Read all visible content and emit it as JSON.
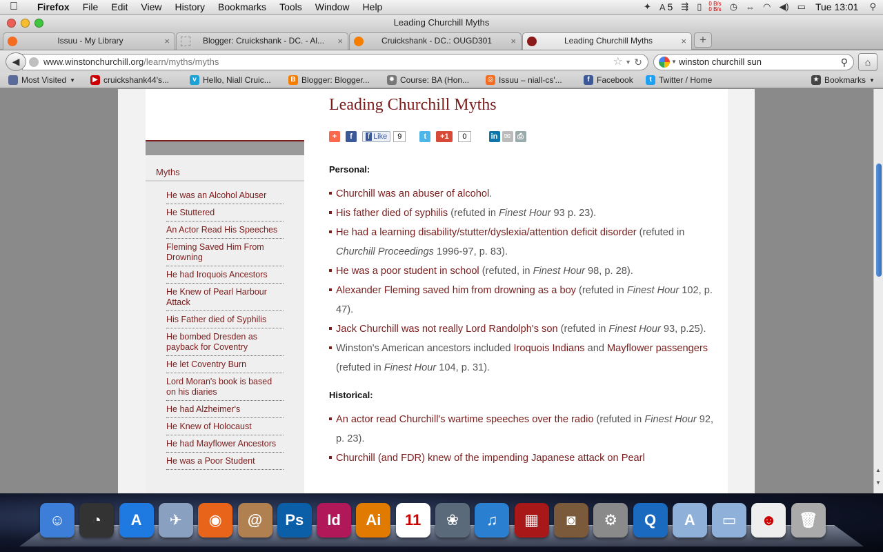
{
  "menubar": {
    "app": "Firefox",
    "menus": [
      "File",
      "Edit",
      "View",
      "History",
      "Bookmarks",
      "Tools",
      "Window",
      "Help"
    ],
    "adobe_count": "5",
    "net_up": "0 B/s",
    "net_down": "0 B/s",
    "clock": "Tue 13:01"
  },
  "window": {
    "title": "Leading Churchill Myths"
  },
  "tabs": [
    {
      "label": "Issuu - My Library",
      "fav_color": "#f36c21"
    },
    {
      "label": "Blogger: Cruickshank - DC. - Al...",
      "fav_color": "#ffffff"
    },
    {
      "label": "Cruickshank - DC.: OUGD301",
      "fav_color": "#f57d00"
    },
    {
      "label": "Leading Churchill Myths",
      "fav_color": "#8b1a1a"
    }
  ],
  "address": {
    "domain": "www.winstonchurchill.org",
    "path": "/learn/myths/myths"
  },
  "search": {
    "value": "winston churchill sun"
  },
  "bookmarks": [
    {
      "label": "Most Visited",
      "color": "#5a6a9a"
    },
    {
      "label": "cruickshank44's...",
      "color": "#cc0000"
    },
    {
      "label": "Hello, Niall Cruic...",
      "color": "#1aa1d6"
    },
    {
      "label": "Blogger: Blogger...",
      "color": "#f57d00"
    },
    {
      "label": "Course: BA (Hon...",
      "color": "#777777"
    },
    {
      "label": "Issuu – niall-cs'...",
      "color": "#f36c21"
    },
    {
      "label": "Facebook",
      "color": "#3b5998"
    },
    {
      "label": "Twitter / Home",
      "color": "#1da1f2"
    },
    {
      "label": "Bookmarks",
      "color": "#444444"
    }
  ],
  "sidebar": {
    "title": "Myths",
    "items": [
      "He was an Alcohol Abuser",
      "He Stuttered",
      "An Actor Read His Speeches",
      "Fleming Saved Him From Drowning",
      "He had Iroquois Ancestors",
      "He Knew of Pearl Harbour Attack",
      "His Father died of Syphilis",
      "He bombed Dresden as payback for Coventry",
      "He let Coventry Burn",
      "Lord Moran's book is based on his diaries",
      "He had Alzheimer's",
      "He Knew of Holocaust",
      "He had Mayflower Ancestors",
      "He was a Poor Student"
    ]
  },
  "article": {
    "title": "Leading Churchill Myths",
    "share": {
      "like_label": "Like",
      "like_count": "9",
      "gplus_label": "+1",
      "gplus_count": "0"
    },
    "personal_heading": "Personal:",
    "historical_heading": "Historical:",
    "personal": [
      {
        "link": "Churchill was an abuser of alcohol",
        "pre": "",
        "ref": "",
        "em": "",
        "post": "."
      },
      {
        "link": "His father died of syphilis",
        "pre": "",
        "ref": " (refuted in ",
        "em": "Finest Hour",
        "post": " 93 p. 23)."
      },
      {
        "link": "He had a learning disability/stutter/dyslexia/attention deficit disorder",
        "pre": "",
        "ref": " (refuted in ",
        "em": "Churchill Proceedings",
        "post": " 1996-97, p. 83)."
      },
      {
        "link": "He was a poor student in school",
        "pre": "",
        "ref": " (refuted, in ",
        "em": "Finest Hour",
        "post": " 98, p. 28)."
      },
      {
        "link": "Alexander Fleming saved him from drowning as a boy",
        "pre": "",
        "ref": " (refuted in ",
        "em": "Finest Hour",
        "post": " 102, p. 47)."
      },
      {
        "link": "Jack Churchill was not really Lord Randolph's son",
        "pre": "",
        "ref": " (refuted in ",
        "em": "Finest Hour",
        "post": " 93, p.25)."
      },
      {
        "link": "",
        "pre": "Winston's American ancestors included ",
        "link2": "Iroquois Indians",
        "mid": " and ",
        "link3": "Mayflower passengers",
        "ref": " (refuted in ",
        "em": "Finest Hour",
        "post": " 104, p. 31)."
      }
    ],
    "historical": [
      {
        "link": "An actor read Churchill's wartime speeches over the radio",
        "ref": " (refuted in ",
        "em": "Finest Hour",
        "post": " 92, p. 23)."
      },
      {
        "link": "Churchill (and FDR) knew of the impending Japanese attack on Pearl",
        "ref": "",
        "em": "",
        "post": ""
      }
    ]
  },
  "dock": [
    {
      "name": "finder-icon",
      "glyph": "☺",
      "color": "#3d7ed8"
    },
    {
      "name": "dashboard-icon",
      "glyph": "◔",
      "color": "#333333"
    },
    {
      "name": "app-store-icon",
      "glyph": "A",
      "color": "#1e7ae0"
    },
    {
      "name": "preview-icon",
      "glyph": "✈",
      "color": "#8aa0c0"
    },
    {
      "name": "firefox-icon",
      "glyph": "◉",
      "color": "#e8641b"
    },
    {
      "name": "address-book-icon",
      "glyph": "@",
      "color": "#b08050"
    },
    {
      "name": "photoshop-icon",
      "glyph": "Ps",
      "color": "#0b5fa8"
    },
    {
      "name": "indesign-icon",
      "glyph": "Id",
      "color": "#b0185a"
    },
    {
      "name": "illustrator-icon",
      "glyph": "Ai",
      "color": "#e07a00"
    },
    {
      "name": "ical-icon",
      "glyph": "11",
      "color": "#ffffff"
    },
    {
      "name": "iphoto-icon",
      "glyph": "❀",
      "color": "#5a6a7a"
    },
    {
      "name": "itunes-icon",
      "glyph": "♫",
      "color": "#2a7fd0"
    },
    {
      "name": "photo-booth-icon",
      "glyph": "▦",
      "color": "#a81818"
    },
    {
      "name": "image-capture-icon",
      "glyph": "◙",
      "color": "#7a5a3a"
    },
    {
      "name": "system-preferences-icon",
      "glyph": "⚙",
      "color": "#8a8a8a"
    },
    {
      "name": "quicktime-icon",
      "glyph": "Q",
      "color": "#1a6ac0"
    },
    {
      "name": "applications-folder-icon",
      "glyph": "A",
      "color": "#8fb0d8"
    },
    {
      "name": "documents-folder-icon",
      "glyph": "▭",
      "color": "#8fb0d8"
    },
    {
      "name": "churchill-photo-icon",
      "glyph": "☻",
      "color": "#eeeeee"
    },
    {
      "name": "trash-icon",
      "glyph": "🗑",
      "color": "#aaaaaa"
    }
  ]
}
